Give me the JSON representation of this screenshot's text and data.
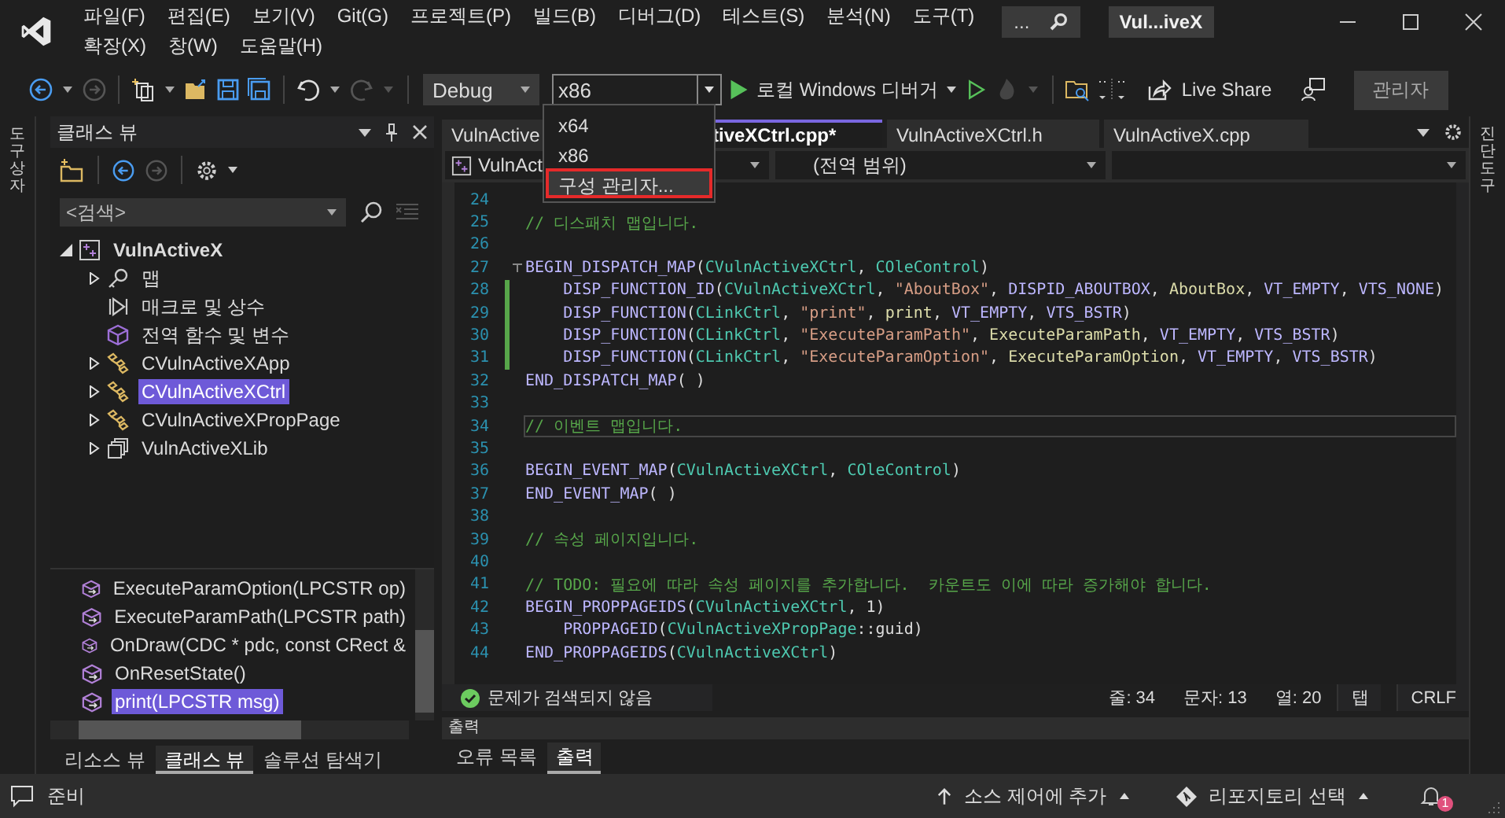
{
  "menu_rows": [
    [
      "파일(F)",
      "편집(E)",
      "보기(V)",
      "Git(G)",
      "프로젝트(P)",
      "빌드(B)",
      "디버그(D)",
      "테스트(S)",
      "분석(N)",
      "도구(T)"
    ],
    [
      "확장(X)",
      "창(W)",
      "도움말(H)"
    ]
  ],
  "search": {
    "value": "..."
  },
  "window": {
    "title": "Vul...iveX"
  },
  "toolbar": {
    "configuration": "Debug",
    "platform": "x86",
    "debugger": "로컬 Windows 디버거",
    "live_share": "Live Share",
    "admin": "관리자"
  },
  "platform_menu": [
    {
      "label": "x64",
      "selected": false
    },
    {
      "label": "x86",
      "selected": false
    },
    {
      "label": "구성 관리자...",
      "selected": true
    }
  ],
  "left_strip": "도구 상자",
  "right_strip": "진단 도구",
  "class_view": {
    "title": "클래스 뷰",
    "search_placeholder": "<검색>",
    "tree": [
      {
        "label": "VulnActiveX",
        "kind": "project",
        "expanded": true,
        "selected": false,
        "children": [
          {
            "label": "맵",
            "kind": "map",
            "expanded": false,
            "selected": false
          },
          {
            "label": "매크로 및 상수",
            "kind": "macro",
            "selected": false
          },
          {
            "label": "전역 함수 및 변수",
            "kind": "global",
            "selected": false
          },
          {
            "label": "CVulnActiveXApp",
            "kind": "class",
            "expanded": false,
            "selected": false
          },
          {
            "label": "CVulnActiveXCtrl",
            "kind": "class",
            "expanded": false,
            "selected": true
          },
          {
            "label": "CVulnActiveXPropPage",
            "kind": "class",
            "expanded": false,
            "selected": false
          },
          {
            "label": "VulnActiveXLib",
            "kind": "library",
            "expanded": false,
            "selected": false
          }
        ]
      }
    ],
    "members": [
      {
        "label": "ExecuteParamOption(LPCSTR op)",
        "selected": false
      },
      {
        "label": "ExecuteParamPath(LPCSTR path)",
        "selected": false
      },
      {
        "label": "OnDraw(CDC * pdc, const CRect &",
        "selected": false
      },
      {
        "label": "OnResetState()",
        "selected": false
      },
      {
        "label": "print(LPCSTR msg)",
        "selected": true
      }
    ],
    "tabs": [
      {
        "label": "리소스 뷰",
        "selected": false
      },
      {
        "label": "클래스 뷰",
        "selected": true
      },
      {
        "label": "솔루션 탐색기",
        "selected": false
      }
    ]
  },
  "editor": {
    "tabs": [
      {
        "label": "VulnActive",
        "selected": false
      },
      {
        "label": "tiveXCtrl.cpp*",
        "selected": true
      },
      {
        "label": "VulnActiveXCtrl.h",
        "selected": false
      },
      {
        "label": "VulnActiveX.cpp",
        "selected": false
      }
    ],
    "nav": {
      "project": "VulnAct",
      "scope": "(전역 범위)"
    },
    "lines": [
      {
        "number": "24"
      },
      {
        "number": "25",
        "segments": [
          {
            "kind": "comment",
            "text": "// 디스패치 맵입니다."
          }
        ]
      },
      {
        "number": "26"
      },
      {
        "number": "27",
        "fold": true,
        "segments": [
          {
            "kind": "macro",
            "text": "BEGIN_DISPATCH_MAP"
          },
          {
            "kind": "plain",
            "text": "("
          },
          {
            "kind": "type",
            "text": "CVulnActiveXCtrl"
          },
          {
            "kind": "plain",
            "text": ", "
          },
          {
            "kind": "type",
            "text": "COleControl"
          },
          {
            "kind": "plain",
            "text": ")"
          }
        ]
      },
      {
        "number": "28",
        "indent": true,
        "changed": true,
        "segments": [
          {
            "kind": "macro",
            "text": "DISP_FUNCTION_ID"
          },
          {
            "kind": "plain",
            "text": "("
          },
          {
            "kind": "type",
            "text": "CVulnActiveXCtrl"
          },
          {
            "kind": "plain",
            "text": ", "
          },
          {
            "kind": "string",
            "text": "\"AboutBox\""
          },
          {
            "kind": "plain",
            "text": ", "
          },
          {
            "kind": "macro",
            "text": "DISPID_ABOUTBOX"
          },
          {
            "kind": "plain",
            "text": ", "
          },
          {
            "kind": "func",
            "text": "AboutBox"
          },
          {
            "kind": "plain",
            "text": ", "
          },
          {
            "kind": "macro",
            "text": "VT_EMPTY"
          },
          {
            "kind": "plain",
            "text": ", "
          },
          {
            "kind": "macro",
            "text": "VTS_NONE"
          },
          {
            "kind": "plain",
            "text": ")"
          }
        ]
      },
      {
        "number": "29",
        "indent": true,
        "changed": true,
        "segments": [
          {
            "kind": "macro",
            "text": "DISP_FUNCTION"
          },
          {
            "kind": "plain",
            "text": "("
          },
          {
            "kind": "type",
            "text": "CLinkCtrl"
          },
          {
            "kind": "plain",
            "text": ", "
          },
          {
            "kind": "string",
            "text": "\"print\""
          },
          {
            "kind": "plain",
            "text": ", "
          },
          {
            "kind": "func",
            "text": "print"
          },
          {
            "kind": "plain",
            "text": ", "
          },
          {
            "kind": "macro",
            "text": "VT_EMPTY"
          },
          {
            "kind": "plain",
            "text": ", "
          },
          {
            "kind": "macro",
            "text": "VTS_BSTR"
          },
          {
            "kind": "plain",
            "text": ")"
          }
        ]
      },
      {
        "number": "30",
        "indent": true,
        "changed": true,
        "segments": [
          {
            "kind": "macro",
            "text": "DISP_FUNCTION"
          },
          {
            "kind": "plain",
            "text": "("
          },
          {
            "kind": "type",
            "text": "CLinkCtrl"
          },
          {
            "kind": "plain",
            "text": ", "
          },
          {
            "kind": "string",
            "text": "\"ExecuteParamPath\""
          },
          {
            "kind": "plain",
            "text": ", "
          },
          {
            "kind": "func",
            "text": "ExecuteParamPath"
          },
          {
            "kind": "plain",
            "text": ", "
          },
          {
            "kind": "macro",
            "text": "VT_EMPTY"
          },
          {
            "kind": "plain",
            "text": ", "
          },
          {
            "kind": "macro",
            "text": "VTS_BSTR"
          },
          {
            "kind": "plain",
            "text": ")"
          }
        ]
      },
      {
        "number": "31",
        "indent": true,
        "changed": true,
        "segments": [
          {
            "kind": "macro",
            "text": "DISP_FUNCTION"
          },
          {
            "kind": "plain",
            "text": "("
          },
          {
            "kind": "type",
            "text": "CLinkCtrl"
          },
          {
            "kind": "plain",
            "text": ", "
          },
          {
            "kind": "string",
            "text": "\"ExecuteParamOption\""
          },
          {
            "kind": "plain",
            "text": ", "
          },
          {
            "kind": "func",
            "text": "ExecuteParamOption"
          },
          {
            "kind": "plain",
            "text": ", "
          },
          {
            "kind": "macro",
            "text": "VT_EMPTY"
          },
          {
            "kind": "plain",
            "text": ", "
          },
          {
            "kind": "macro",
            "text": "VTS_BSTR"
          },
          {
            "kind": "plain",
            "text": ")"
          }
        ]
      },
      {
        "number": "32",
        "segments": [
          {
            "kind": "macro",
            "text": "END_DISPATCH_MAP"
          },
          {
            "kind": "plain",
            "text": "( )"
          }
        ]
      },
      {
        "number": "33"
      },
      {
        "number": "34",
        "current": true,
        "segments": [
          {
            "kind": "comment",
            "text": "// 이벤트 맵입니다."
          }
        ]
      },
      {
        "number": "35"
      },
      {
        "number": "36",
        "segments": [
          {
            "kind": "macro",
            "text": "BEGIN_EVENT_MAP"
          },
          {
            "kind": "plain",
            "text": "("
          },
          {
            "kind": "type",
            "text": "CVulnActiveXCtrl"
          },
          {
            "kind": "plain",
            "text": ", "
          },
          {
            "kind": "type",
            "text": "COleControl"
          },
          {
            "kind": "plain",
            "text": ")"
          }
        ]
      },
      {
        "number": "37",
        "segments": [
          {
            "kind": "macro",
            "text": "END_EVENT_MAP"
          },
          {
            "kind": "plain",
            "text": "( )"
          }
        ]
      },
      {
        "number": "38"
      },
      {
        "number": "39",
        "segments": [
          {
            "kind": "comment",
            "text": "// 속성 페이지입니다."
          }
        ]
      },
      {
        "number": "40"
      },
      {
        "number": "41",
        "segments": [
          {
            "kind": "comment",
            "text": "// TODO: 필요에 따라 속성 페이지를 추가합니다.  카운트도 이에 따라 증가해야 합니다."
          }
        ]
      },
      {
        "number": "42",
        "segments": [
          {
            "kind": "macro",
            "text": "BEGIN_PROPPAGEIDS"
          },
          {
            "kind": "plain",
            "text": "("
          },
          {
            "kind": "type",
            "text": "CVulnActiveXCtrl"
          },
          {
            "kind": "plain",
            "text": ", 1)"
          }
        ]
      },
      {
        "number": "43",
        "indent": true,
        "segments": [
          {
            "kind": "macro",
            "text": "PROPPAGEID"
          },
          {
            "kind": "plain",
            "text": "("
          },
          {
            "kind": "type",
            "text": "CVulnActiveXPropPage"
          },
          {
            "kind": "plain",
            "text": "::guid)"
          }
        ]
      },
      {
        "number": "44",
        "segments": [
          {
            "kind": "macro",
            "text": "END_PROPPAGEIDS"
          },
          {
            "kind": "plain",
            "text": "("
          },
          {
            "kind": "type",
            "text": "CVulnActiveXCtrl"
          },
          {
            "kind": "plain",
            "text": ")"
          }
        ]
      }
    ],
    "status": {
      "issues": "문제가 검색되지 않음",
      "line": "줄: 34",
      "char": "문자: 13",
      "col": "열: 20",
      "indent": "탭",
      "eol": "CRLF"
    }
  },
  "output": {
    "title": "출력",
    "tabs": [
      {
        "label": "오류 목록",
        "selected": false
      },
      {
        "label": "출력",
        "selected": true
      }
    ]
  },
  "status_bar": {
    "text": "준비",
    "source_control": "소스 제어에 추가",
    "repository": "리포지토리 선택",
    "notifications": "1"
  }
}
